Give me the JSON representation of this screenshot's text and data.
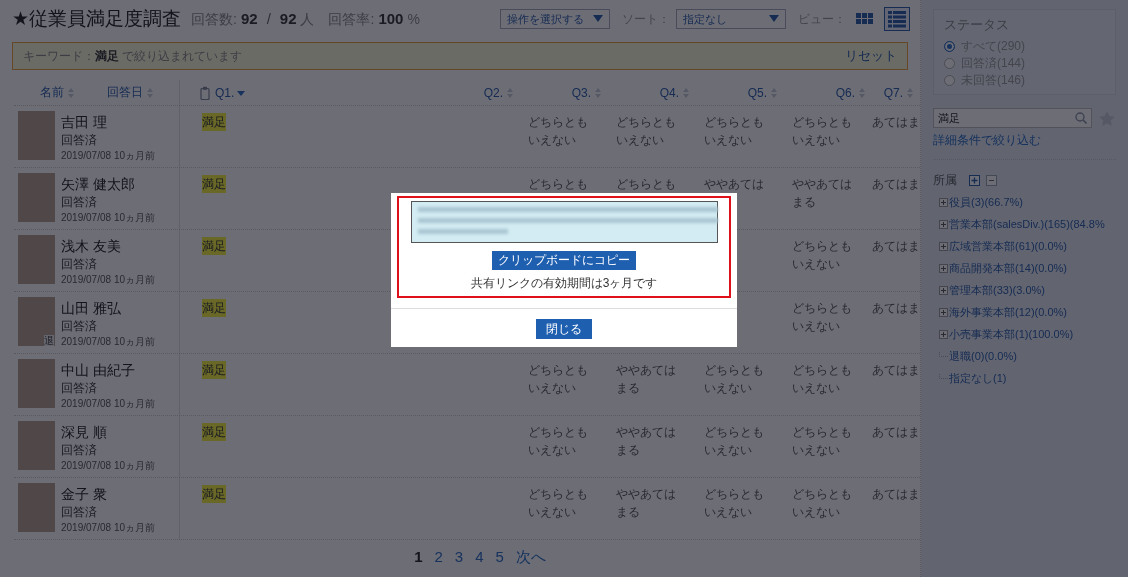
{
  "header": {
    "title": "★従業員満足度調査",
    "responses_label": "回答数:",
    "responses": "92",
    "separator": "/",
    "total": "92",
    "unit": "人",
    "rate_label": "回答率:",
    "rate": "100",
    "rate_unit": "%",
    "action_select": "操作を選択する",
    "sort_label": "ソート：",
    "sort_select": "指定なし",
    "view_label": "ビュー：",
    "views": [
      {
        "kind": "grid",
        "selected": false
      },
      {
        "kind": "list",
        "selected": true
      }
    ]
  },
  "filter_bar": {
    "message": "キーワード：**満足** で絞り込まれています",
    "reset": "リセット"
  },
  "table": {
    "name_columns": [
      {
        "label": "名前",
        "sorted": false
      },
      {
        "label": "回答日",
        "sorted": false
      }
    ],
    "question_columns": [
      {
        "label": "Q1.",
        "sorted": true,
        "attachment": true
      },
      {
        "label": "Q2.",
        "sorted": false
      },
      {
        "label": "Q3.",
        "sorted": false
      },
      {
        "label": "Q4.",
        "sorted": false
      },
      {
        "label": "Q5.",
        "sorted": false
      },
      {
        "label": "Q6.",
        "sorted": false
      },
      {
        "label": "Q7.",
        "sorted": false
      }
    ],
    "rows": [
      {
        "name": "吉田 理",
        "status": "回答済",
        "date": "2019/07/08",
        "ago": "10ヵ月前",
        "q1": {
          "text": "満足",
          "highlighted": true
        },
        "answers": {
          "q3": "どちらともいえない",
          "q4": "どちらともいえない",
          "q5": "どちらともいえない",
          "q6": "どちらともいえない",
          "q7": "あてはま"
        }
      },
      {
        "name": "矢澤 健太郎",
        "status": "回答済",
        "date": "2019/07/08",
        "ago": "10ヵ月前",
        "q1": {
          "text": "満足",
          "highlighted": true
        },
        "answers": {
          "q3": "どちらとも",
          "q4": "どちらとも",
          "q5": "ややあては",
          "q6": "ややあてはまる",
          "q7": "あてはま"
        }
      },
      {
        "name": "浅木 友美",
        "status": "回答済",
        "date": "2019/07/08",
        "ago": "10ヵ月前",
        "q1": {
          "text": "満足",
          "highlighted": true
        },
        "answers": {
          "q6": "どちらともいえない",
          "q7": "あてはま"
        }
      },
      {
        "name": "山田 雅弘",
        "status": "回答済",
        "date": "2019/07/08",
        "ago": "10ヵ月前",
        "badge": "退",
        "q1": {
          "text": "満足",
          "highlighted": true
        },
        "answers": {
          "q6": "どちらともいえない",
          "q7": "あてはま"
        }
      },
      {
        "name": "中山 由紀子",
        "status": "回答済",
        "date": "2019/07/08",
        "ago": "10ヵ月前",
        "q1": {
          "text": "満足",
          "highlighted": true
        },
        "answers": {
          "q3": "どちらともいえない",
          "q4": "ややあてはまる",
          "q5": "どちらともいえない",
          "q6": "どちらともいえない",
          "q7": "あてはま"
        }
      },
      {
        "name": "深見 順",
        "status": "回答済",
        "date": "2019/07/08",
        "ago": "10ヵ月前",
        "q1": {
          "text": "満足",
          "highlighted": true
        },
        "answers": {
          "q3": "どちらともいえない",
          "q4": "ややあてはまる",
          "q5": "どちらともいえない",
          "q6": "どちらともいえない",
          "q7": "あてはま"
        }
      },
      {
        "name": "金子 衆",
        "status": "回答済",
        "date": "2019/07/08",
        "ago": "10ヵ月前",
        "q1": {
          "text": "満足",
          "highlighted": true
        },
        "answers": {
          "q3": "どちらともいえない",
          "q4": "ややあてはまる",
          "q5": "どちらともいえない",
          "q6": "どちらともいえない",
          "q7": "あてはま"
        }
      }
    ]
  },
  "pagination": {
    "pages": [
      {
        "label": "1",
        "selected": true
      },
      {
        "label": "2",
        "selected": false
      },
      {
        "label": "3",
        "selected": false
      },
      {
        "label": "4",
        "selected": false
      },
      {
        "label": "5",
        "selected": false
      }
    ],
    "next": "次へ"
  },
  "sidebar": {
    "status": {
      "title": "ステータス",
      "options": [
        {
          "label": "すべて(290)",
          "selected": true
        },
        {
          "label": "回答済(144)",
          "selected": false
        },
        {
          "label": "未回答(146)",
          "selected": false
        }
      ]
    },
    "search": {
      "value": "満足"
    },
    "advanced_link": "詳細条件で絞り込む",
    "departments": {
      "title": "所属",
      "tree": [
        {
          "label": "役員(3)(66.7%)",
          "kind": "branch"
        },
        {
          "label": "営業本部(salesDiv.)(165)(84.8%",
          "kind": "branch"
        },
        {
          "label": "広域営業本部(61)(0.0%)",
          "kind": "branch"
        },
        {
          "label": "商品開発本部(14)(0.0%)",
          "kind": "branch"
        },
        {
          "label": "管理本部(33)(3.0%)",
          "kind": "branch"
        },
        {
          "label": "海外事業本部(12)(0.0%)",
          "kind": "branch"
        },
        {
          "label": "小売事業本部(1)(100.0%)",
          "kind": "branch"
        },
        {
          "label": "退職(0)(0.0%)",
          "kind": "leaf"
        },
        {
          "label": "指定なし(1)",
          "kind": "leaf"
        }
      ]
    }
  },
  "modal": {
    "copy_button": "クリップボードにコピー",
    "note": "共有リンクの有効期間は3ヶ月です",
    "close_button": "閉じる"
  }
}
